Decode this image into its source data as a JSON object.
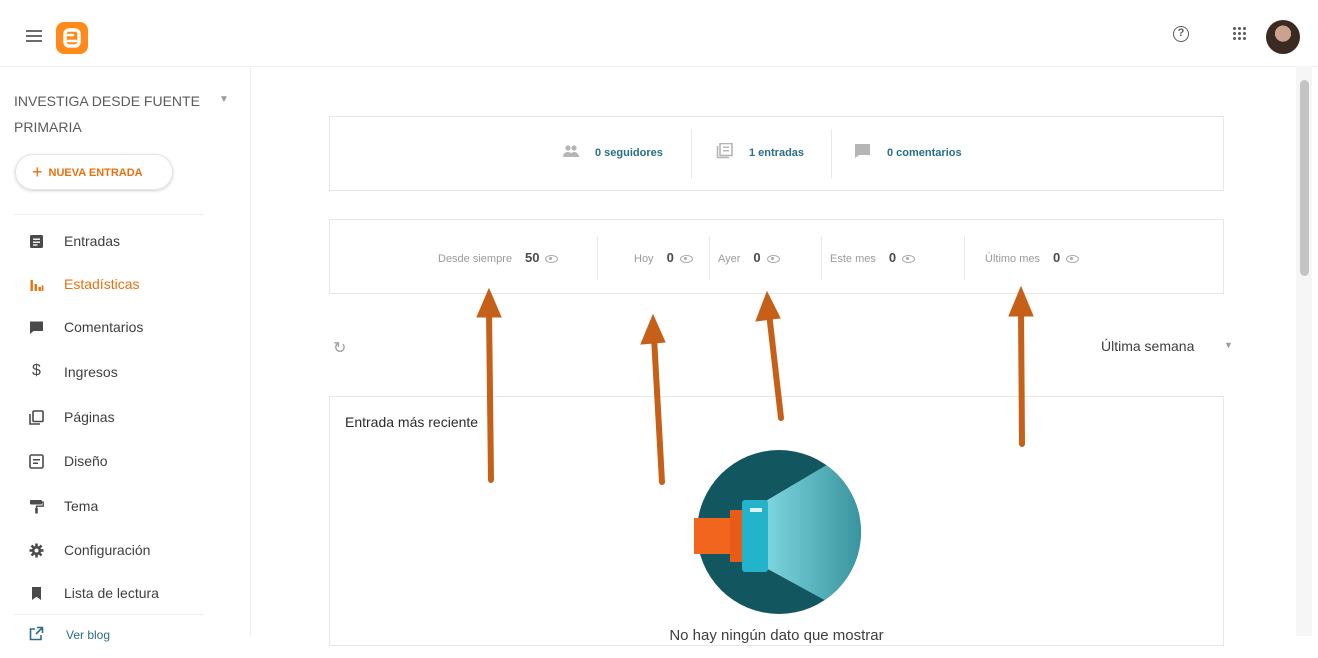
{
  "header": {
    "menu_icon": "hamburger-icon",
    "logo_icon": "blogger-logo-icon",
    "help_icon": "help-circle-icon",
    "apps_icon": "apps-grid-icon",
    "avatar_icon": "user-avatar"
  },
  "sidebar": {
    "blog_title": "INVESTIGA DESDE FUENTE PRIMARIA",
    "new_entry": "NUEVA ENTRADA",
    "items": [
      {
        "label": "Entradas",
        "icon": "posts-icon"
      },
      {
        "label": "Estadísticas",
        "icon": "stats-icon",
        "active": true
      },
      {
        "label": "Comentarios",
        "icon": "comment-icon"
      },
      {
        "label": "Ingresos",
        "icon": "dollar-icon"
      },
      {
        "label": "Páginas",
        "icon": "pages-icon"
      },
      {
        "label": "Diseño",
        "icon": "layout-icon"
      },
      {
        "label": "Tema",
        "icon": "paint-roller-icon"
      },
      {
        "label": "Configuración",
        "icon": "gear-icon"
      },
      {
        "label": "Lista de lectura",
        "icon": "bookmark-icon"
      },
      {
        "label": "Ver blog",
        "icon": "external-link-icon"
      }
    ]
  },
  "stats": {
    "followers": "0 seguidores",
    "posts": "1 entradas",
    "comments": "0 comentarios"
  },
  "views": {
    "all_time": {
      "label": "Desde siempre",
      "value": "50"
    },
    "today": {
      "label": "Hoy",
      "value": "0"
    },
    "yesterday": {
      "label": "Ayer",
      "value": "0"
    },
    "this_month": {
      "label": "Este mes",
      "value": "0"
    },
    "last_month": {
      "label": "Último mes",
      "value": "0"
    }
  },
  "range": {
    "selected": "Última semana"
  },
  "recent": {
    "title": "Entrada más reciente",
    "empty_text": "No hay ningún dato que mostrar"
  },
  "colors": {
    "accent": "#e8700f",
    "link": "#2a6f85",
    "arrow": "#c65f18"
  }
}
